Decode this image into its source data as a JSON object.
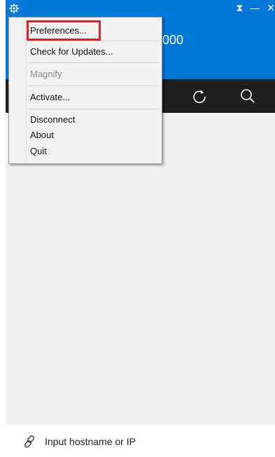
{
  "header": {
    "visible_text": "000",
    "window_controls": [
      "pin-icon",
      "minimize-icon",
      "close-icon"
    ]
  },
  "toolbar": {
    "icons": [
      "refresh-icon",
      "search-icon"
    ]
  },
  "menu": {
    "items": [
      {
        "label": "Preferences...",
        "enabled": true,
        "highlighted": true
      },
      {
        "label": "Check for Updates...",
        "enabled": true
      },
      {
        "label": "Magnify",
        "enabled": false
      },
      {
        "label": "Activate...",
        "enabled": true
      },
      {
        "label": "Disconnect",
        "enabled": true
      },
      {
        "label": "About",
        "enabled": true
      },
      {
        "label": "Quit",
        "enabled": true
      }
    ]
  },
  "footer": {
    "hostname_placeholder": "Input hostname or IP"
  },
  "colors": {
    "header_bg": "#0078d7",
    "toolbar_bg": "#1e1e1e",
    "highlight_border": "#e0202a"
  }
}
